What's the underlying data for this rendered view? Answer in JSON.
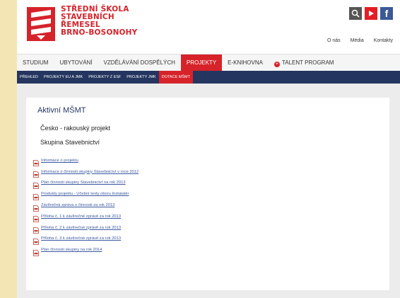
{
  "logo": {
    "lines": [
      "STŘEDNÍ ŠKOLA",
      "STAVEBNÍCH",
      "ŘEMESEL",
      "BRNO-BOSONOHY"
    ]
  },
  "social": {
    "search_icon": "search-icon",
    "youtube_icon": "youtube-icon",
    "facebook_glyph": "f"
  },
  "toplinks": [
    "O nás",
    "Média",
    "Kontakty"
  ],
  "mainnav": [
    "STUDIUM",
    "UBYTOVÁNÍ",
    "VZDĚLÁVÁNÍ DOSPĚLÝCH",
    "PROJEKTY",
    "E-KNIHOVNA",
    "TALENT PROGRAM"
  ],
  "subnav": [
    "PŘEHLED",
    "PROJEKTY EU A JMK",
    "PROJEKTY Z ESF",
    "PROJEKTY JMK",
    "DOTACE MŠMT"
  ],
  "content": {
    "title": "Aktivní MŠMT",
    "line1": "Česko - rakouský projekt",
    "line2": "Skupina Stavebnictví",
    "documents": [
      "Informace o projektu",
      "Informace o činnosti skupiny Stavebnictví v roce 2012",
      "Plán činnosti skupiny Stavebnictví na rok 2013",
      "Produkty projektu - Učební texty oboru Instalatér",
      "Závěrečná zpráva o činnosti za rok 2013",
      "Příloha č. 1 k závěrečné zprávě za rok 2013",
      "Příloha č. 2 k závěrečné zprávě za rok 2013",
      "Příloha č. 3 k závěrečné zprávě za rok 2013",
      "Plán činnosti skupiny na rok 2014"
    ]
  },
  "colors": {
    "brand_red": "#d6232a",
    "navy": "#24355f",
    "link": "#3b5aa0",
    "outer_bg": "#f3e6b4"
  }
}
